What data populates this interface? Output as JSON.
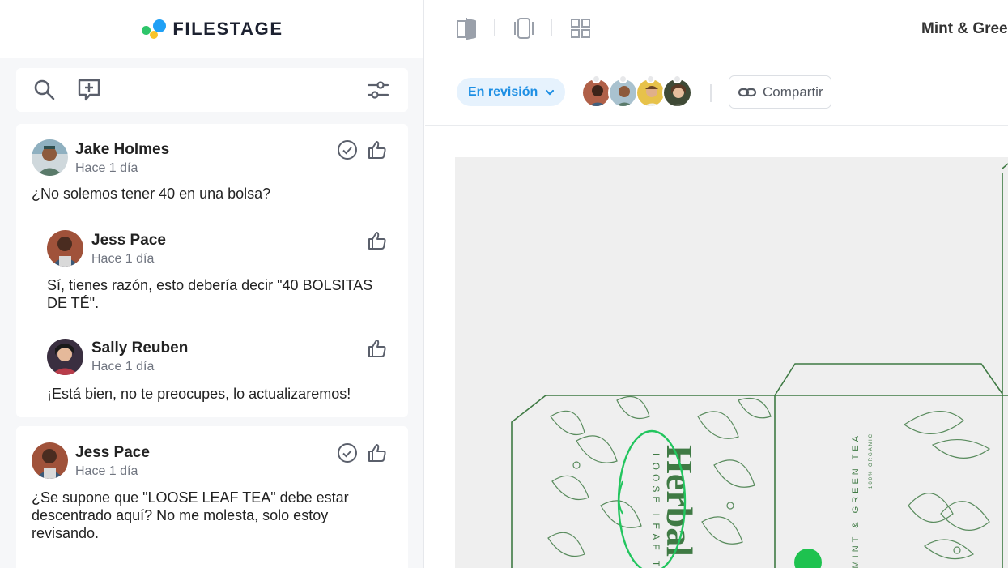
{
  "app": {
    "logo_text": "FILESTAGE"
  },
  "header": {
    "document_title": "Mint & Green"
  },
  "toolbar": {
    "icons": [
      "search-icon",
      "add-comment-icon",
      "filter-icon"
    ]
  },
  "status": {
    "label": "En revisión"
  },
  "share": {
    "label": "Compartir"
  },
  "comments": [
    {
      "author": "Jake Holmes",
      "time": "Hace 1 día",
      "text": "¿No solemos tener 40 en una bolsa?",
      "replies": [
        {
          "author": "Jess Pace",
          "time": "Hace 1 día",
          "text": "Sí, tienes razón, esto debería decir \"40 BOLSITAS DE TÉ\"."
        },
        {
          "author": "Sally Reuben",
          "time": "Hace 1 día",
          "text": "¡Está bien, no te preocupes, lo actualizaremos!"
        }
      ]
    },
    {
      "author": "Jess Pace",
      "time": "Hace 1 día",
      "text": "¿Se supone que \"LOOSE LEAF TEA\" debe estar descentrado aquí? No me molesta, solo estoy revisando."
    }
  ],
  "artwork": {
    "brand": "Herbal",
    "subtitle": "LOOSE LEAF TEA",
    "side_text": "MINT & GREEN TEA",
    "side_small": "100% ORGANIC"
  },
  "colors": {
    "accent": "#1d8fe4",
    "annotation": "#22c55e",
    "artwork_green": "#3f7a44"
  }
}
